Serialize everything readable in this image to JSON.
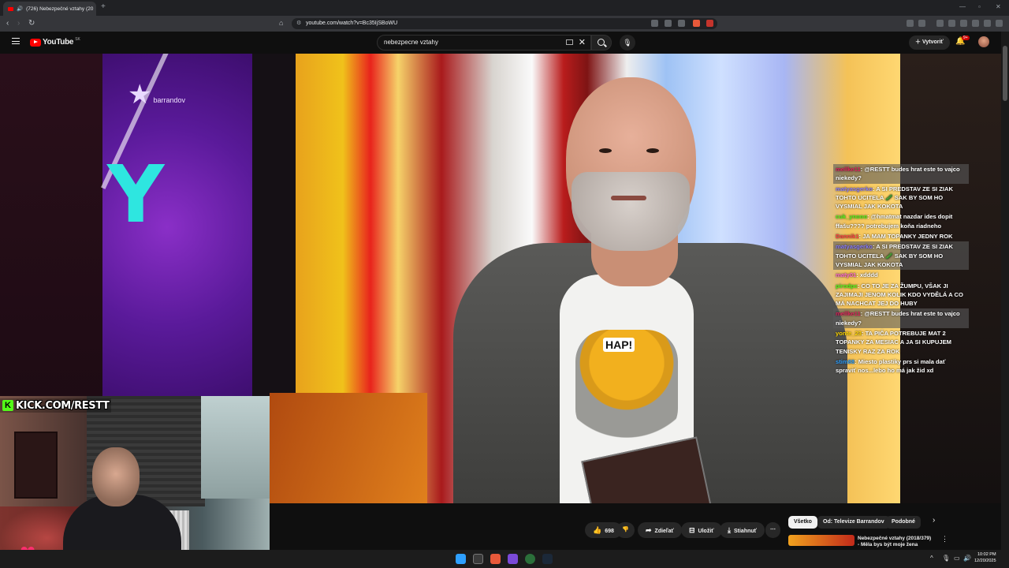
{
  "browser": {
    "tab_title": "(726) Nebezpečné vztahy (20",
    "url": "youtube.com/watch?v=Bc35IjSBoWU"
  },
  "youtube": {
    "logo_text": "YouTube",
    "logo_region": "SK",
    "search_value": "nebezpecne vztahy",
    "create_label": "Vytvoriť",
    "notif_count": "9+"
  },
  "video": {
    "channel_watermark": "barrandov",
    "letter": "Y",
    "shirt_text": "HAP!",
    "kick_url": "KICK.COM/RESTT"
  },
  "chat": [
    {
      "user": "mellke11",
      "text": "@RESTT budes hrat este to vajco niekedy?",
      "user_color": "#e0245e",
      "hl": true
    },
    {
      "user": "matyasgerko",
      "text": "A SI PREDSTAV ZE SI ZIAK TOHTO UCITELA 🥒 SAK BY SOM HO VYSMIAL JAK KOKOTA",
      "user_color": "#8a7dff",
      "hl": false
    },
    {
      "user": "cuk_ynooo",
      "text": "@hmatmat nazdar ides dopit ffašu???? potrebujem koňa riadneho",
      "user_color": "#53fc18",
      "hl": false
    },
    {
      "user": "Dannik1",
      "text": "JA MAM TOPANKY JEDNY ROK",
      "user_color": "#ff4040",
      "hl": false
    },
    {
      "user": "matyasgerko",
      "text": "A SI PREDSTAV ZE SI ZIAK TOHTO UCITELA 🥒 SAK BY SOM HO VYSMIAL JAK KOKOTA",
      "user_color": "#8a7dff",
      "hl": true
    },
    {
      "user": "maty01",
      "text": "xdddd",
      "user_color": "#ff6bd1",
      "hl": false
    },
    {
      "user": "pirodpc",
      "text": "CO TO JE ZA ŽUMPU, VŠAK JI ZAJIMAJI JENOM KOLIK KDO VYDĚLÁ A CO MÁ NACHCAT JEJ DO HUBY",
      "user_color": "#53fc18",
      "hl": false
    },
    {
      "user": "mellke11",
      "text": "@RESTT budes hrat este to vajco niekedy?",
      "user_color": "#e0245e",
      "hl": true
    },
    {
      "user": "yonte_23",
      "text": "TA PIČA POTREBUJE MAT 2 TOPANKY ZA MESIAC A JA SI KUPUJEM TENISKY RAZ ZA ROK",
      "user_color": "#ffd700",
      "hl": false
    },
    {
      "user": "stim88",
      "text": "Miesto plastiky prs si mala dať spraviť nos...lebo ho má jak žid xd",
      "user_color": "#2ea0ff",
      "hl": false
    }
  ],
  "actions": {
    "likes": "698",
    "share": "Zdieľať",
    "save": "Uložiť",
    "download": "Stiahnuť"
  },
  "chips": [
    "Všetko",
    "Od: Televize Barrandov",
    "Podobné"
  ],
  "recommended": {
    "title_line1": "Nebezpečné vztahy (2018/379)",
    "title_line2": "- Měla bys být moje žena"
  },
  "taskbar": {
    "time": "10:02 PM",
    "date": "12/20/2025"
  },
  "colors": {
    "accent": "#ff0000",
    "kick_green": "#53fc18"
  }
}
